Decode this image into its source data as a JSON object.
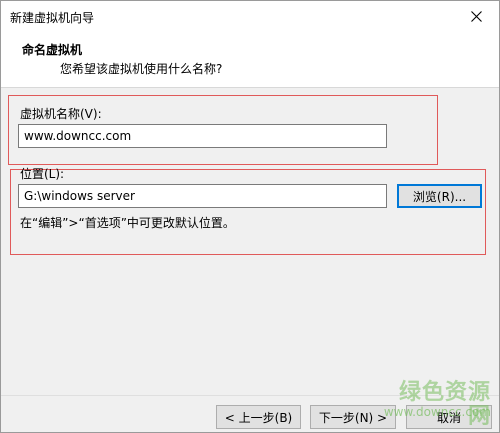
{
  "window": {
    "title": "新建虚拟机向导"
  },
  "header": {
    "title": "命名虚拟机",
    "subtitle": "您希望该虚拟机使用什么名称?"
  },
  "name_section": {
    "label": "虚拟机名称(V):",
    "value": "www.downcc.com"
  },
  "location_section": {
    "label": "位置(L):",
    "value": "G:\\windows server",
    "browse_label": "浏览(R)...",
    "hint": "在“编辑”>“首选项”中可更改默认位置。"
  },
  "footer": {
    "back_label": "< 上一步(B)",
    "next_label": "下一步(N) >",
    "cancel_label": "取消"
  },
  "watermark": {
    "text": "绿色资源网",
    "url": "www.downcc.com"
  },
  "colors": {
    "highlight_border": "#e05a5a",
    "focus_blue": "#0078d7",
    "watermark_green": "#78be5f"
  }
}
